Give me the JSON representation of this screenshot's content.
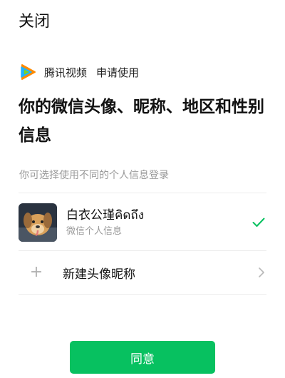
{
  "header": {
    "close_label": "关闭"
  },
  "app": {
    "name": "腾讯视频",
    "action": "申请使用"
  },
  "title": "你的微信头像、昵称、地区和性别信息",
  "hint": "你可选择使用不同的个人信息登录",
  "profiles": [
    {
      "nickname": "白衣公瑾คิดถึง",
      "subtitle": "微信个人信息",
      "selected": true
    }
  ],
  "new_profile": {
    "label": "新建头像昵称"
  },
  "agree_button": {
    "label": "同意"
  },
  "colors": {
    "accent": "#07c160",
    "text": "#111111",
    "secondary": "#9a9a9a",
    "divider": "#ececec"
  },
  "icons": [
    "tencent-video-logo-icon",
    "check-icon",
    "plus-icon",
    "chevron-right-icon"
  ]
}
